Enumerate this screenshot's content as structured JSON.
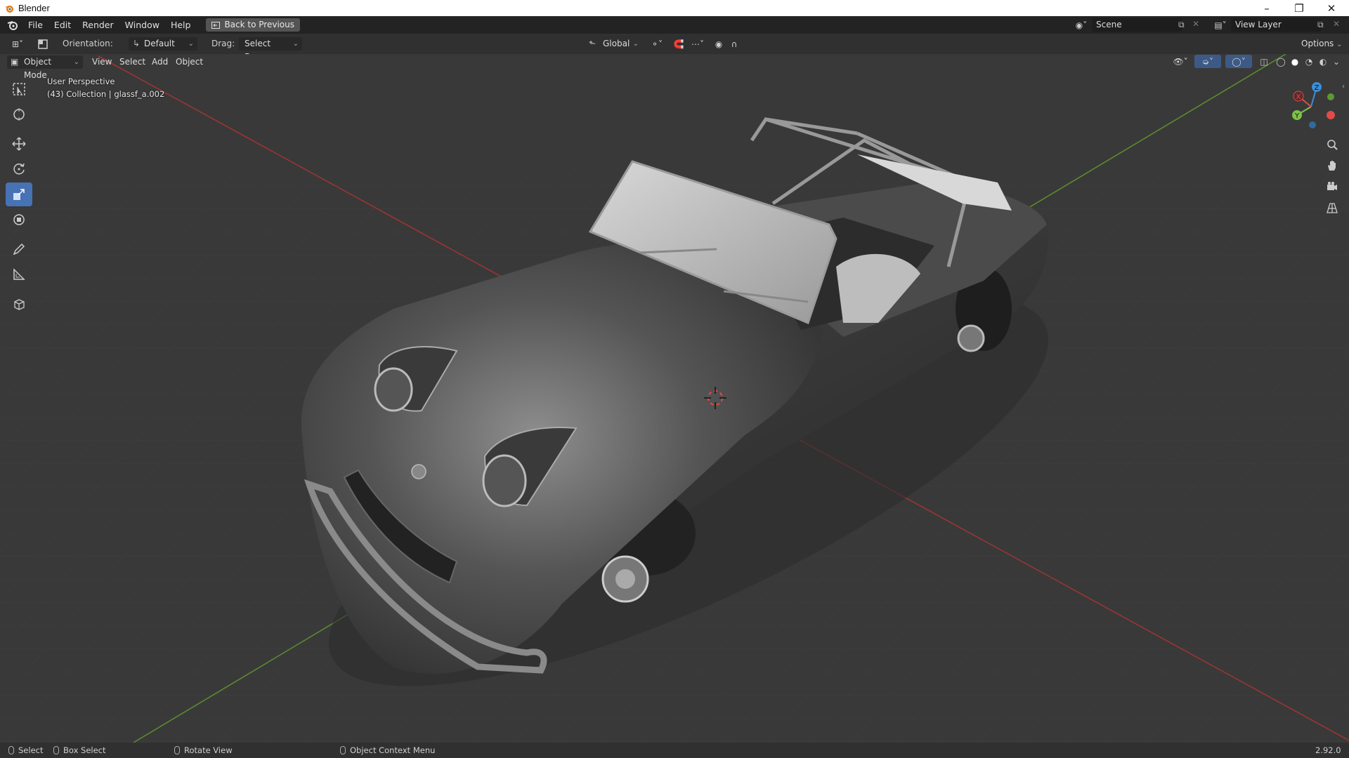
{
  "window": {
    "title": "Blender"
  },
  "menu": {
    "items": [
      "File",
      "Edit",
      "Render",
      "Window",
      "Help"
    ],
    "back_button": "Back to Previous",
    "scene": "Scene",
    "view_layer": "View Layer"
  },
  "tool_header": {
    "orientation_label": "Orientation:",
    "orientation_value": "Default",
    "drag_label": "Drag:",
    "drag_value": "Select Box",
    "transform_orientation": "Global",
    "options": "Options"
  },
  "viewport_header": {
    "mode": "Object Mode",
    "menus": [
      "View",
      "Select",
      "Add",
      "Object"
    ]
  },
  "viewport": {
    "perspective": "User Perspective",
    "collection": "(43) Collection | glassf_a.002"
  },
  "gizmo": {
    "x": "X",
    "y": "Y",
    "z": "Z"
  },
  "statusbar": {
    "select": "Select",
    "box_select": "Box Select",
    "rotate_view": "Rotate View",
    "context_menu": "Object Context Menu",
    "version": "2.92.0"
  },
  "colors": {
    "accent": "#4772b3",
    "x_axis": "#e04b4b",
    "y_axis": "#7dc247",
    "z_axis": "#3a8fd8",
    "viewport_bg": "#393939"
  }
}
